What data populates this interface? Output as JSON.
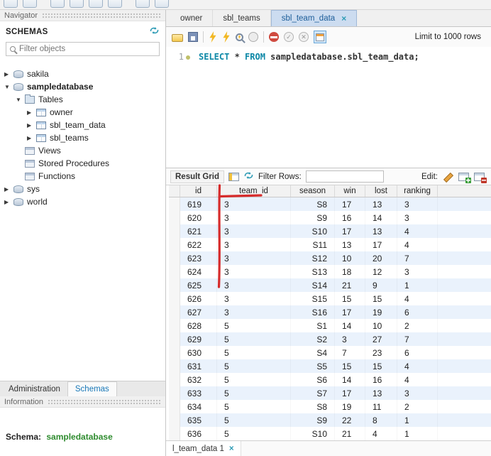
{
  "colors": {
    "annotation_red": "#d62b2b",
    "schema_value_green": "#2e8b2e",
    "sql_keyword_teal": "#0b87a6",
    "active_tab_text_blue": "#1c5d99",
    "row_stripe_blue": "#eaf2fc"
  },
  "icons": {
    "expand": "▶",
    "collapse": "▼",
    "close": "×",
    "check": "✓",
    "cross": "✕"
  },
  "navigator": {
    "title": "Navigator",
    "schemas_header": "SCHEMAS",
    "filter_placeholder": "Filter objects",
    "tree": [
      {
        "label": "sakila",
        "arrow": "▶"
      },
      {
        "label": "sampledatabase",
        "arrow": "▼"
      },
      {
        "label": "Tables",
        "arrow": "▼"
      },
      {
        "label": "owner",
        "arrow": "▶"
      },
      {
        "label": "sbl_team_data",
        "arrow": "▶"
      },
      {
        "label": "sbl_teams",
        "arrow": "▶"
      },
      {
        "label": "Views",
        "arrow": ""
      },
      {
        "label": "Stored Procedures",
        "arrow": ""
      },
      {
        "label": "Functions",
        "arrow": ""
      },
      {
        "label": "sys",
        "arrow": "▶"
      },
      {
        "label": "world",
        "arrow": "▶"
      }
    ],
    "tabs": {
      "administration": "Administration",
      "schemas": "Schemas"
    },
    "information_title": "Information",
    "schema_label": "Schema:",
    "schema_value": "sampledatabase"
  },
  "editor": {
    "tabs": [
      {
        "label": "owner"
      },
      {
        "label": "sbl_teams"
      },
      {
        "label": "sbl_team_data"
      }
    ],
    "toolbar": {
      "limit_label": "Limit to 1000 rows"
    },
    "line_number": "1",
    "sql": {
      "kw_select": "SELECT",
      "star": " * ",
      "kw_from": "FROM",
      "object": " sampledatabase.sbl_team_data;"
    }
  },
  "result": {
    "toolbar": {
      "grid_label": "Result Grid",
      "filter_label": "Filter Rows:",
      "filter_value": "",
      "edit_label": "Edit:"
    },
    "columns": [
      "id",
      "team_id",
      "season",
      "win",
      "lost",
      "ranking"
    ],
    "rows": [
      [
        "619",
        "3",
        "S8",
        "17",
        "13",
        "3"
      ],
      [
        "620",
        "3",
        "S9",
        "16",
        "14",
        "3"
      ],
      [
        "621",
        "3",
        "S10",
        "17",
        "13",
        "4"
      ],
      [
        "622",
        "3",
        "S11",
        "13",
        "17",
        "4"
      ],
      [
        "623",
        "3",
        "S12",
        "10",
        "20",
        "7"
      ],
      [
        "624",
        "3",
        "S13",
        "18",
        "12",
        "3"
      ],
      [
        "625",
        "3",
        "S14",
        "21",
        "9",
        "1"
      ],
      [
        "626",
        "3",
        "S15",
        "15",
        "15",
        "4"
      ],
      [
        "627",
        "3",
        "S16",
        "17",
        "19",
        "6"
      ],
      [
        "628",
        "5",
        "S1",
        "14",
        "10",
        "2"
      ],
      [
        "629",
        "5",
        "S2",
        "3",
        "27",
        "7"
      ],
      [
        "630",
        "5",
        "S4",
        "7",
        "23",
        "6"
      ],
      [
        "631",
        "5",
        "S5",
        "15",
        "15",
        "4"
      ],
      [
        "632",
        "5",
        "S6",
        "14",
        "16",
        "4"
      ],
      [
        "633",
        "5",
        "S7",
        "17",
        "13",
        "3"
      ],
      [
        "634",
        "5",
        "S8",
        "19",
        "11",
        "2"
      ],
      [
        "635",
        "5",
        "S9",
        "22",
        "8",
        "1"
      ],
      [
        "636",
        "5",
        "S10",
        "21",
        "4",
        "1"
      ]
    ],
    "result_tab": "l_team_data 1"
  }
}
